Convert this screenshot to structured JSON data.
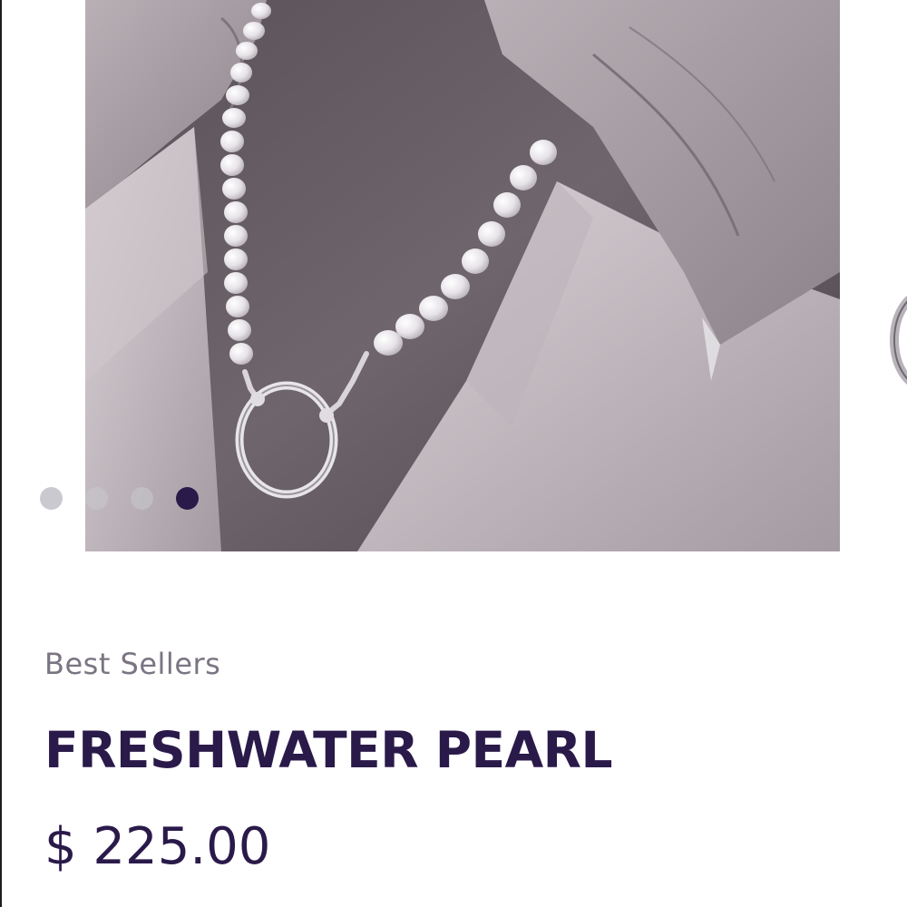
{
  "carousel": {
    "slide_image": "necklace-photo",
    "slide_count": 4,
    "active_slide": 4,
    "indicator_color_active": "#2a1a4a",
    "indicator_color_inactive": "#c9c9cf"
  },
  "product": {
    "category": "Best Sellers",
    "title": "FRESHWATER PEARL",
    "price": "$ 225.00"
  },
  "colors": {
    "brand": "#2a1a4a",
    "muted_text": "#7b7482"
  }
}
